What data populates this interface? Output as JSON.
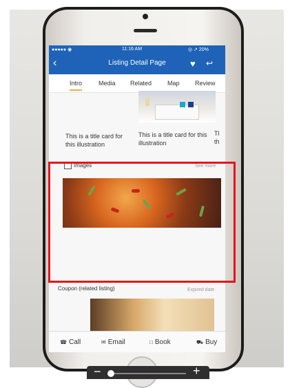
{
  "status_bar": {
    "left": "●●●●● ◉",
    "time": "11:16 AM",
    "right": "◎ ↗ 20%"
  },
  "nav": {
    "back_glyph": "‹",
    "title": "Listing Detail Page",
    "heart_glyph": "♥",
    "share_glyph": "↩"
  },
  "tabs": [
    "Intro",
    "Media",
    "Related",
    "Map",
    "Review"
  ],
  "cards": [
    {
      "title": "This is a title card for this illustration"
    },
    {
      "title": "This is a title card for this illustration"
    },
    {
      "title": "Tl th"
    }
  ],
  "images_section": {
    "title": "Images",
    "more": "See more"
  },
  "coupon": {
    "title": "Coupon (related listing)",
    "date": "Expired date"
  },
  "actions": [
    {
      "icon": "phone-icon",
      "glyph": "☎",
      "label": "Call"
    },
    {
      "icon": "mail-icon",
      "glyph": "✉",
      "label": "Email"
    },
    {
      "icon": "calendar-icon",
      "glyph": "□",
      "label": "Book"
    },
    {
      "icon": "cart-icon",
      "glyph": "⛟",
      "label": "Buy"
    }
  ],
  "zoom": {
    "minus": "−",
    "plus": "+",
    "level": 0.2
  },
  "colors": {
    "nav": "#1e63b8",
    "highlight": "#e5141b",
    "tab_indicator": "#e1b341"
  }
}
